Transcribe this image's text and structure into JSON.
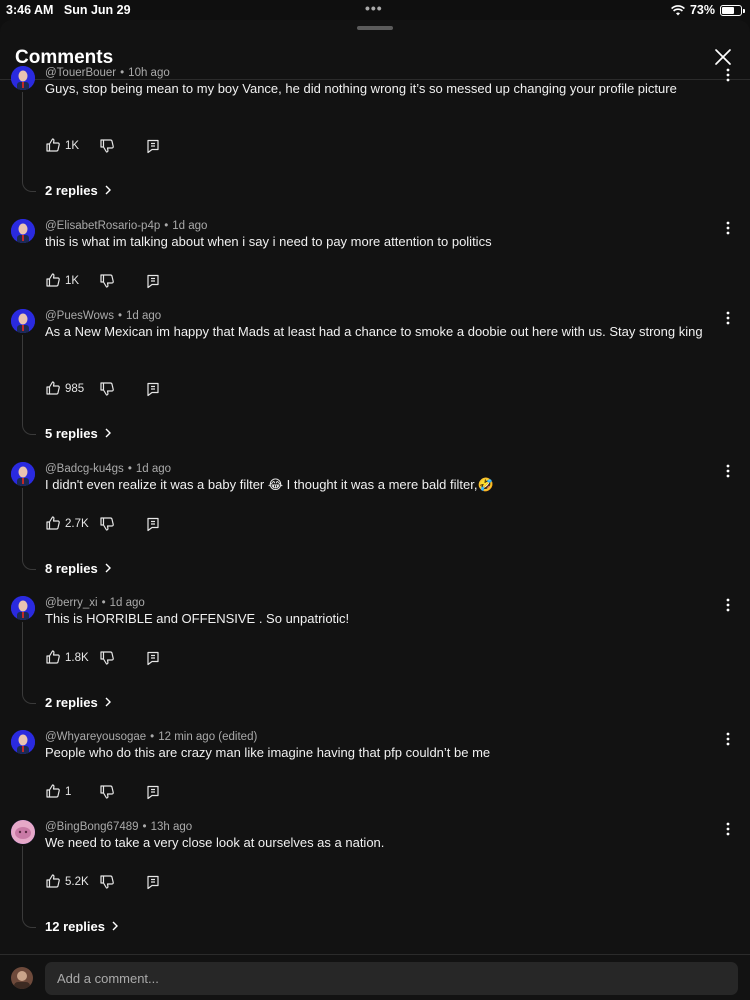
{
  "status": {
    "time": "3:46 AM",
    "date": "Sun Jun 29",
    "battery": "73%",
    "battery_level": 0.73,
    "icons": [
      "wifi-icon",
      "battery-icon"
    ]
  },
  "header": {
    "title": "Comments"
  },
  "comments": [
    {
      "user": "@TouerBouer",
      "time": "10h ago",
      "text": "Guys, stop being mean to my boy Vance, he did nothing wrong it’s so messed up changing your profile picture",
      "likes": "1K",
      "replies": "2 replies"
    },
    {
      "user": "@ElisabetRosario-p4p",
      "time": "1d ago",
      "text": "this is what im talking about when i say i need to pay more attention to politics",
      "likes": "1K",
      "replies": ""
    },
    {
      "user": "@PuesWows",
      "time": "1d ago",
      "text": "As a New Mexican im happy that Mads at least had a chance to smoke a doobie out here with us. Stay strong king",
      "likes": "985",
      "replies": "5 replies"
    },
    {
      "user": "@Badcg-ku4gs",
      "time": "1d ago",
      "text": "I didn't even realize it was a baby filter 😂  I thought it was a mere bald filter,🤣",
      "likes": "2.7K",
      "replies": "8 replies"
    },
    {
      "user": "@berry_xi",
      "time": "1d ago",
      "text": "This is HORRIBLE and OFFENSIVE . So unpatriotic!",
      "likes": "1.8K",
      "replies": "2 replies"
    },
    {
      "user": "@Whyareyousogae",
      "time": "12 min ago (edited)",
      "text": "People who do this are crazy man like imagine having that pfp couldn’t be me",
      "likes": "1",
      "replies": ""
    },
    {
      "user": "@BingBong67489",
      "time": "13h ago",
      "text": "We need to take a very close look at ourselves as a nation.",
      "likes": "5.2K",
      "replies": "12 replies"
    }
  ],
  "composer": {
    "placeholder": "Add a comment..."
  }
}
